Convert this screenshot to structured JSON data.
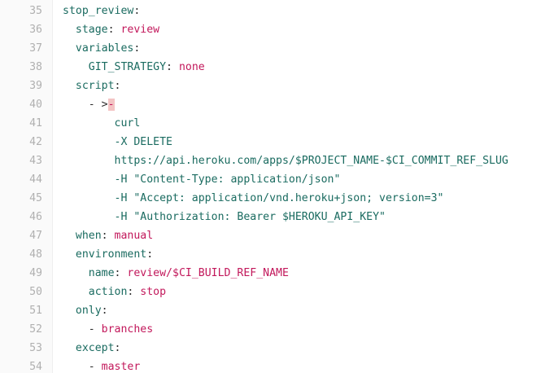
{
  "file": {
    "lines": [
      {
        "num": "35",
        "indent": "",
        "tokens": [
          {
            "t": "stop_review",
            "c": "key"
          },
          {
            "t": ":",
            "c": "punct"
          }
        ]
      },
      {
        "num": "36",
        "indent": "  ",
        "tokens": [
          {
            "t": "stage",
            "c": "key"
          },
          {
            "t": ": ",
            "c": "punct"
          },
          {
            "t": "review",
            "c": "val"
          }
        ]
      },
      {
        "num": "37",
        "indent": "  ",
        "tokens": [
          {
            "t": "variables",
            "c": "key"
          },
          {
            "t": ":",
            "c": "punct"
          }
        ]
      },
      {
        "num": "38",
        "indent": "    ",
        "tokens": [
          {
            "t": "GIT_STRATEGY",
            "c": "key"
          },
          {
            "t": ": ",
            "c": "punct"
          },
          {
            "t": "none",
            "c": "val"
          }
        ]
      },
      {
        "num": "39",
        "indent": "  ",
        "tokens": [
          {
            "t": "script",
            "c": "key"
          },
          {
            "t": ":",
            "c": "punct"
          }
        ]
      },
      {
        "num": "40",
        "indent": "    ",
        "tokens": [
          {
            "t": "- >",
            "c": "punct"
          },
          {
            "t": "-",
            "c": "err"
          }
        ]
      },
      {
        "num": "41",
        "indent": "        ",
        "tokens": [
          {
            "t": "curl",
            "c": "str"
          }
        ]
      },
      {
        "num": "42",
        "indent": "        ",
        "tokens": [
          {
            "t": "-X DELETE",
            "c": "str"
          }
        ]
      },
      {
        "num": "43",
        "indent": "        ",
        "tokens": [
          {
            "t": "https://api.heroku.com/apps/$PROJECT_NAME-$CI_COMMIT_REF_SLUG",
            "c": "str"
          }
        ]
      },
      {
        "num": "44",
        "indent": "        ",
        "tokens": [
          {
            "t": "-H \"Content-Type: application/json\"",
            "c": "str"
          }
        ]
      },
      {
        "num": "45",
        "indent": "        ",
        "tokens": [
          {
            "t": "-H \"Accept: application/vnd.heroku+json; version=3\"",
            "c": "str"
          }
        ]
      },
      {
        "num": "46",
        "indent": "        ",
        "tokens": [
          {
            "t": "-H \"Authorization: Bearer $HEROKU_API_KEY\"",
            "c": "str"
          }
        ]
      },
      {
        "num": "47",
        "indent": "  ",
        "tokens": [
          {
            "t": "when",
            "c": "key"
          },
          {
            "t": ": ",
            "c": "punct"
          },
          {
            "t": "manual",
            "c": "val"
          }
        ]
      },
      {
        "num": "48",
        "indent": "  ",
        "tokens": [
          {
            "t": "environment",
            "c": "key"
          },
          {
            "t": ":",
            "c": "punct"
          }
        ]
      },
      {
        "num": "49",
        "indent": "    ",
        "tokens": [
          {
            "t": "name",
            "c": "key"
          },
          {
            "t": ": ",
            "c": "punct"
          },
          {
            "t": "review/$CI_BUILD_REF_NAME",
            "c": "val"
          }
        ]
      },
      {
        "num": "50",
        "indent": "    ",
        "tokens": [
          {
            "t": "action",
            "c": "key"
          },
          {
            "t": ": ",
            "c": "punct"
          },
          {
            "t": "stop",
            "c": "val"
          }
        ]
      },
      {
        "num": "51",
        "indent": "  ",
        "tokens": [
          {
            "t": "only",
            "c": "key"
          },
          {
            "t": ":",
            "c": "punct"
          }
        ]
      },
      {
        "num": "52",
        "indent": "    ",
        "tokens": [
          {
            "t": "- ",
            "c": "punct"
          },
          {
            "t": "branches",
            "c": "val"
          }
        ]
      },
      {
        "num": "53",
        "indent": "  ",
        "tokens": [
          {
            "t": "except",
            "c": "key"
          },
          {
            "t": ":",
            "c": "punct"
          }
        ]
      },
      {
        "num": "54",
        "indent": "    ",
        "tokens": [
          {
            "t": "- ",
            "c": "punct"
          },
          {
            "t": "master",
            "c": "val"
          }
        ]
      }
    ]
  },
  "colors": {
    "key": "#1a6b60",
    "value": "#c2185b",
    "line_number": "#b0b0b0",
    "error_highlight": "#f3c4c4"
  }
}
